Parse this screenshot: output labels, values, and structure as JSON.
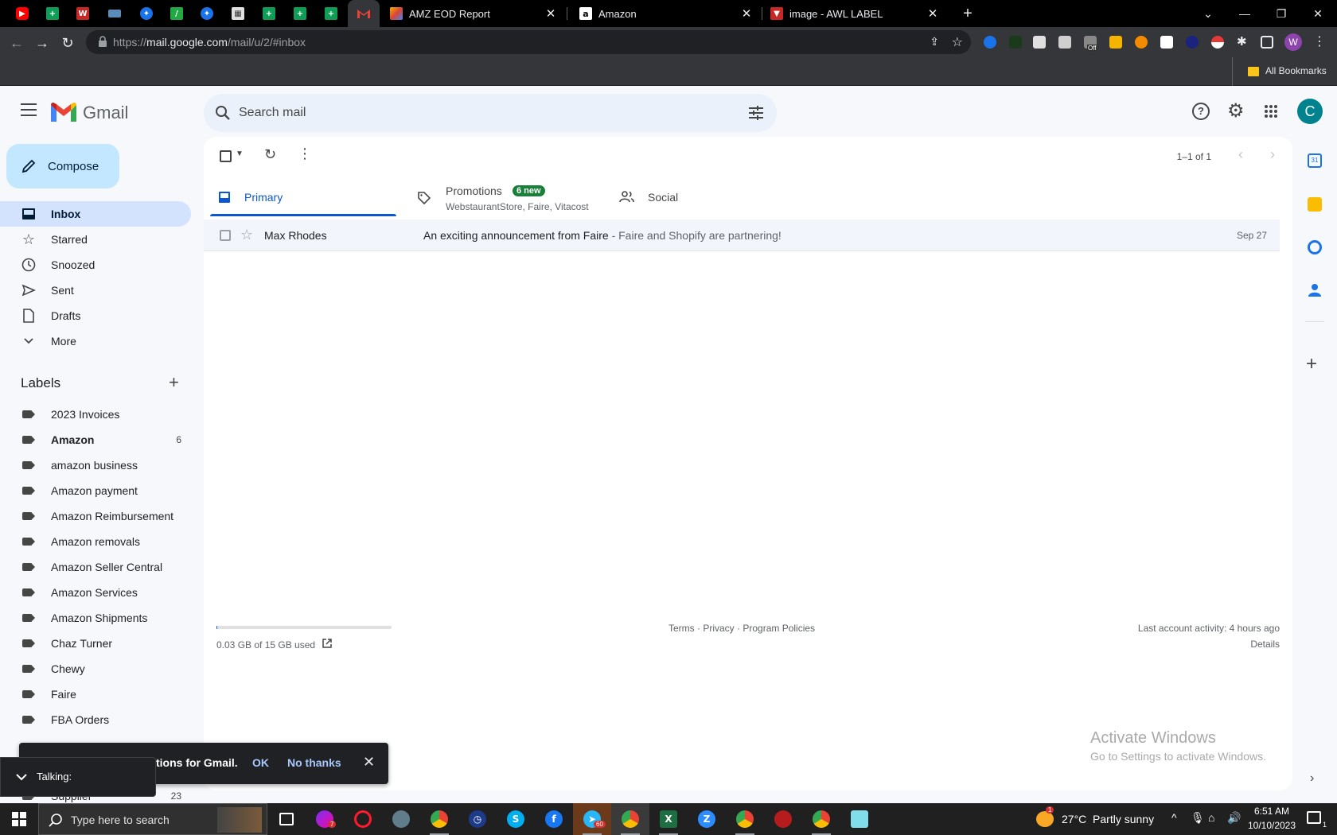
{
  "browser": {
    "tabs": [
      {
        "title": "AMZ EOD Report",
        "icon": "report-favicon"
      },
      {
        "title": "Amazon",
        "icon": "amazon-favicon"
      },
      {
        "title": "image - AWL LABEL",
        "icon": "label-favicon"
      }
    ],
    "new_tab": "+",
    "url_scheme": "https://",
    "url_host": "mail.google.com",
    "url_path": "/mail/u/2/#inbox",
    "bookmarks_label": "All Bookmarks",
    "profile_initial": "W",
    "extension_badge": "Off"
  },
  "gmail": {
    "logo_text": "Gmail",
    "search_placeholder": "Search mail",
    "avatar_initial": "C",
    "compose_label": "Compose",
    "nav": [
      {
        "label": "Inbox",
        "icon": "inbox-icon"
      },
      {
        "label": "Starred",
        "icon": "star-icon"
      },
      {
        "label": "Snoozed",
        "icon": "clock-icon"
      },
      {
        "label": "Sent",
        "icon": "send-icon"
      },
      {
        "label": "Drafts",
        "icon": "draft-icon"
      },
      {
        "label": "More",
        "icon": "chevron-down-icon"
      }
    ],
    "labels_heading": "Labels",
    "labels": [
      {
        "name": "2023 Invoices",
        "count": ""
      },
      {
        "name": "Amazon",
        "count": "6"
      },
      {
        "name": "amazon business",
        "count": ""
      },
      {
        "name": "Amazon payment",
        "count": ""
      },
      {
        "name": "Amazon Reimbursement",
        "count": ""
      },
      {
        "name": "Amazon removals",
        "count": ""
      },
      {
        "name": "Amazon Seller Central",
        "count": ""
      },
      {
        "name": "Amazon Services",
        "count": ""
      },
      {
        "name": "Amazon Shipments",
        "count": ""
      },
      {
        "name": "Chaz Turner",
        "count": ""
      },
      {
        "name": "Chewy",
        "count": ""
      },
      {
        "name": "Faire",
        "count": ""
      },
      {
        "name": "FBA Orders",
        "count": ""
      },
      {
        "name": "Supplier",
        "count": "23"
      }
    ],
    "pagination": "1–1 of 1",
    "tabs": {
      "primary": "Primary",
      "promotions": "Promotions",
      "promotions_badge": "6 new",
      "promotions_senders": "WebstaurantStore, Faire, Vitacost",
      "social": "Social"
    },
    "messages": [
      {
        "sender": "Max Rhodes",
        "subject": "An exciting announcement from Faire",
        "snippet": " - Faire and Shopify are partnering!",
        "date": "Sep 27"
      }
    ],
    "storage": {
      "text": "0.03 GB of 15 GB used",
      "fraction": 0.002
    },
    "footer_links": [
      "Terms",
      "Privacy",
      "Program Policies"
    ],
    "footer_sep": " · ",
    "last_activity": "Last account activity: 4 hours ago",
    "details": "Details",
    "watermark_title": "Activate Windows",
    "watermark_sub": "Go to Settings to activate Windows.",
    "snackbar": {
      "text": "tions for Gmail.",
      "ok": "OK",
      "no_thanks": "No thanks"
    },
    "talking": "Talking:"
  },
  "taskbar": {
    "search_placeholder": "Type here to search",
    "weather": "27°C  Partly sunny",
    "time": "6:51 AM",
    "date": "10/10/2023",
    "notification_count": "1",
    "badge_60": "60",
    "badge_7": "7"
  }
}
